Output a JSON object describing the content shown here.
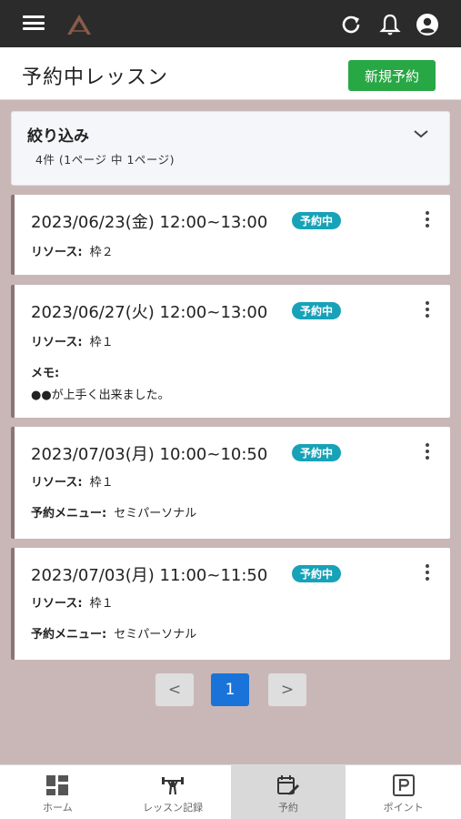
{
  "header": {
    "title": "予約中レッスン",
    "new_button": "新規予約"
  },
  "filter": {
    "title": "絞り込み",
    "count": "4件 (1ページ 中 1ページ)"
  },
  "cards": [
    {
      "datetime": "2023/06/23(金) 12:00~13:00",
      "status": "予約中",
      "resource_label": "リソース:",
      "resource": "枠２"
    },
    {
      "datetime": "2023/06/27(火) 12:00~13:00",
      "status": "予約中",
      "resource_label": "リソース:",
      "resource": "枠１",
      "memo_label": "メモ:",
      "memo": "●●が上手く出来ました。"
    },
    {
      "datetime": "2023/07/03(月) 10:00~10:50",
      "status": "予約中",
      "resource_label": "リソース:",
      "resource": "枠１",
      "menu_label": "予約メニュー:",
      "menu": "セミパーソナル"
    },
    {
      "datetime": "2023/07/03(月) 11:00~11:50",
      "status": "予約中",
      "resource_label": "リソース:",
      "resource": "枠１",
      "menu_label": "予約メニュー:",
      "menu": "セミパーソナル"
    }
  ],
  "pagination": {
    "prev": "<",
    "current": "1",
    "next": ">"
  },
  "nav": [
    {
      "label": "ホーム",
      "icon": "dashboard-icon"
    },
    {
      "label": "レッスン記録",
      "icon": "weightlifting-icon"
    },
    {
      "label": "予約",
      "icon": "calendar-edit-icon",
      "active": true
    },
    {
      "label": "ポイント",
      "icon": "parking-icon"
    }
  ],
  "colors": {
    "accent": "#28a745",
    "badge": "#17a2b8",
    "page_bg": "#c9b7b7",
    "topbar": "#2b2b2b",
    "pager_active": "#1a73d9"
  }
}
